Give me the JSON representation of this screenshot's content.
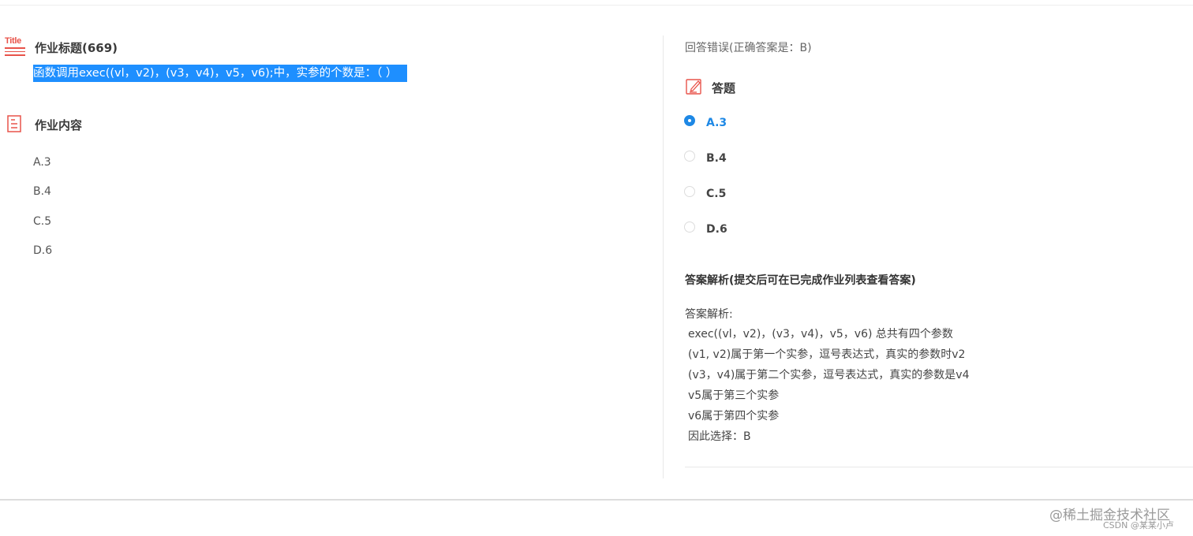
{
  "homework": {
    "title_icon_text": "Title",
    "title": "作业标题(669)",
    "question": "函数调用exec((vl，v2)，(v3，v4)，v5，v6);中，实参的个数是：（ ）",
    "content_title": "作业内容",
    "options": [
      "A.3",
      "B.4",
      "C.5",
      "D.6"
    ]
  },
  "answer": {
    "result": "回答错误(正确答案是：B)",
    "section_title": "答题",
    "options": [
      {
        "label": "A.3",
        "selected": true
      },
      {
        "label": "B.4",
        "selected": false
      },
      {
        "label": "C.5",
        "selected": false
      },
      {
        "label": "D.6",
        "selected": false
      }
    ],
    "analysis_title": "答案解析(提交后可在已完成作业列表查看答案)",
    "analysis_label": "答案解析:",
    "analysis_lines": [
      "exec((vl，v2)，(v3，v4)，v5，v6) 总共有四个参数",
      "(v1, v2)属于第一个实参，逗号表达式，真实的参数时v2",
      "(v3，v4)属于第二个实参，逗号表达式，真实的参数是v4",
      "v5属于第三个实参",
      "v6属于第四个实参",
      "因此选择：B"
    ]
  },
  "watermark": {
    "line1": "@稀土掘金技术社区",
    "line2": "CSDN @某某小卢"
  },
  "colors": {
    "accent_blue": "#1e88e5",
    "highlight_blue": "#1e8fff",
    "icon_red": "#e8534a"
  }
}
